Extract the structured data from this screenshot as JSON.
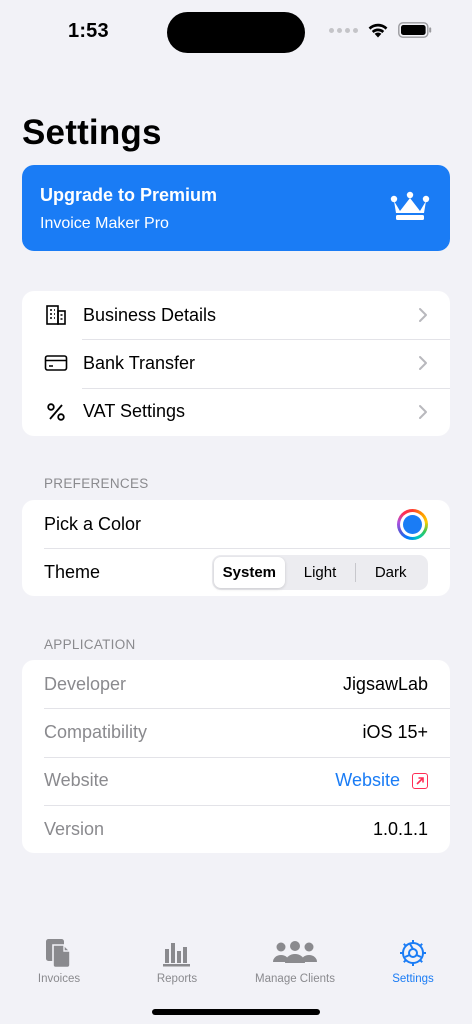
{
  "status": {
    "time": "1:53"
  },
  "page": {
    "title": "Settings"
  },
  "premium": {
    "title": "Upgrade to Premium",
    "subtitle": "Invoice Maker Pro",
    "icon": "crown-icon"
  },
  "business_section": {
    "items": [
      {
        "label": "Business Details",
        "icon": "building-icon"
      },
      {
        "label": "Bank Transfer",
        "icon": "card-icon"
      },
      {
        "label": "VAT Settings",
        "icon": "percent-icon"
      }
    ]
  },
  "preferences": {
    "header": "PREFERENCES",
    "pick_color_label": "Pick a Color",
    "selected_color": "#1a7cf5",
    "theme_label": "Theme",
    "theme_options": [
      "System",
      "Light",
      "Dark"
    ],
    "theme_selected": "System"
  },
  "application": {
    "header": "APPLICATION",
    "rows": [
      {
        "label": "Developer",
        "value": "JigsawLab"
      },
      {
        "label": "Compatibility",
        "value": "iOS 15+"
      },
      {
        "label": "Website",
        "value": "Website"
      },
      {
        "label": "Version",
        "value": "1.0.1.1"
      }
    ]
  },
  "tab_bar": {
    "tabs": [
      {
        "label": "Invoices",
        "icon": "documents-icon"
      },
      {
        "label": "Reports",
        "icon": "bar-chart-icon"
      },
      {
        "label": "Manage Clients",
        "icon": "people-icon"
      },
      {
        "label": "Settings",
        "icon": "gear-icon"
      }
    ],
    "active": "Settings"
  },
  "colors": {
    "accent": "#1a7cf5",
    "background": "#f2f2f7",
    "secondary_text": "#8a8a8e",
    "link_icon": "#ff2d55"
  }
}
